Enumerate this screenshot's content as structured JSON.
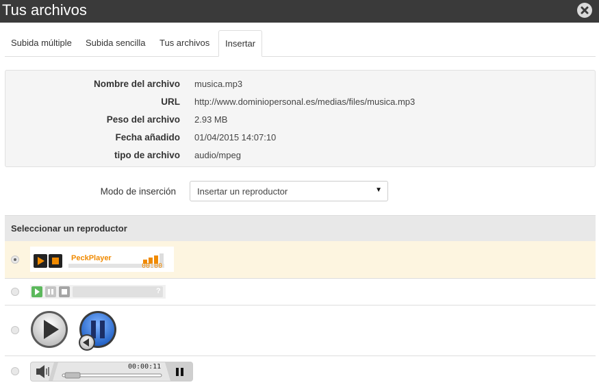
{
  "window": {
    "title": "Tus archivos"
  },
  "tabs": [
    {
      "label": "Subida múltiple"
    },
    {
      "label": "Subida sencilla"
    },
    {
      "label": "Tus archivos"
    },
    {
      "label": "Insertar",
      "active": true
    }
  ],
  "file_info": {
    "rows": [
      {
        "label": "Nombre del archivo",
        "value": "musica.mp3"
      },
      {
        "label": "URL",
        "value": "http://www.dominiopersonal.es/medias/files/musica.mp3"
      },
      {
        "label": "Peso del archivo",
        "value": "2.93 MB"
      },
      {
        "label": "Fecha añadido",
        "value": "01/04/2015 14:07:10"
      },
      {
        "label": "tipo de archivo",
        "value": "audio/mpeg"
      }
    ]
  },
  "insert": {
    "label": "Modo de inserción",
    "selected": "Insertar un reproductor"
  },
  "players": {
    "heading": "Seleccionar un reproductor",
    "selected_index": 0,
    "peck": {
      "name": "PeckPlayer",
      "time": "00:00"
    },
    "simple": {
      "help": "?"
    },
    "native": {
      "time": "00:00:11"
    }
  },
  "colors": {
    "accent": "#f08a00",
    "titlebar": "#3a3a3a",
    "selected_row": "#fdf5e0",
    "green": "#5cb85c",
    "blue": "#2a6fd6"
  }
}
